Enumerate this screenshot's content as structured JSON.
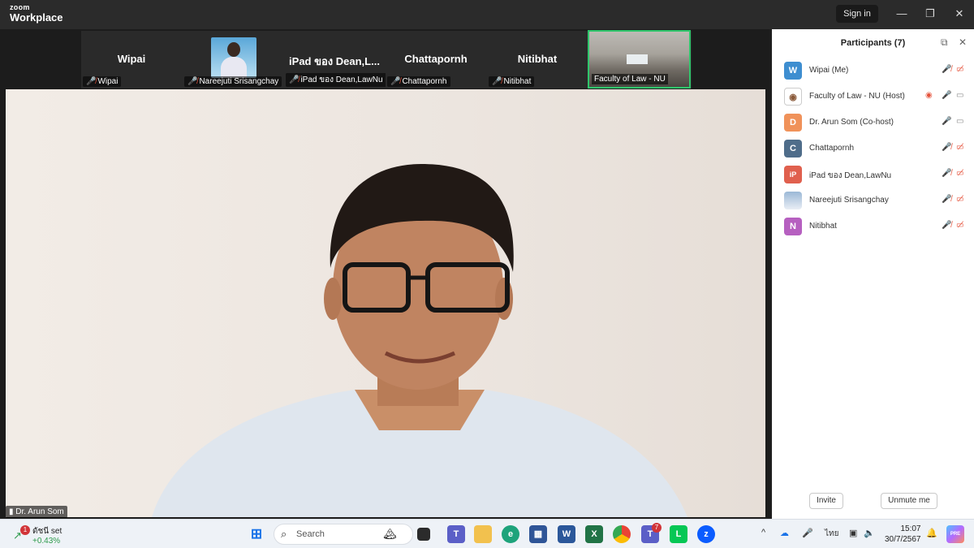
{
  "app": {
    "brand_small": "zoom",
    "brand_large": "Workplace",
    "sign_in": "Sign in"
  },
  "window_controls": {
    "minimize": "—",
    "restore": "❐",
    "close": "✕"
  },
  "thumbnails": [
    {
      "name": "Wipai",
      "label": "Wipai"
    },
    {
      "name": "",
      "label": "Nareejuti Srisangchay"
    },
    {
      "name": "iPad ของ Dean,L...",
      "label": "iPad ของ Dean,LawNu"
    },
    {
      "name": "Chattapornh",
      "label": "Chattapornh"
    },
    {
      "name": "Nitibhat",
      "label": "Nitibhat"
    }
  ],
  "active_thumbnail": {
    "label": "Faculty of Law - NU",
    "border_color": "#2fc56b"
  },
  "main_video": {
    "speaker_label": "Dr. Arun Som"
  },
  "participants": {
    "title": "Participants (7)",
    "list": [
      {
        "initial": "W",
        "color": "#3e8ed0",
        "name": "Wipai (Me)",
        "muted": true
      },
      {
        "initial": "",
        "color": "#ffffff",
        "name": "Faculty of Law - NU (Host)",
        "muted": false
      },
      {
        "initial": "D",
        "color": "#f0925a",
        "name": "Dr. Arun Som (Co-host)",
        "muted": false
      },
      {
        "initial": "C",
        "color": "#4f6d8a",
        "name": "Chattapornh",
        "muted": true
      },
      {
        "initial": "iP",
        "color": "#e0604e",
        "name": "iPad ของ Dean,LawNu",
        "muted": true
      },
      {
        "initial": "",
        "color": "#9bb8d6",
        "name": "Nareejuti Srisangchay",
        "muted": true
      },
      {
        "initial": "N",
        "color": "#b660c0",
        "name": "Nitibhat",
        "muted": true
      }
    ],
    "invite": "Invite",
    "unmute_me": "Unmute me"
  },
  "taskbar": {
    "stock_name": "ดัชนี set",
    "stock_change": "+0.43%",
    "stock_badge": "1",
    "search_placeholder": "Search",
    "teams_badge": "7",
    "language": "ไทย",
    "time": "15:07",
    "date": "30/7/2567",
    "copilot_label": "PRE"
  }
}
